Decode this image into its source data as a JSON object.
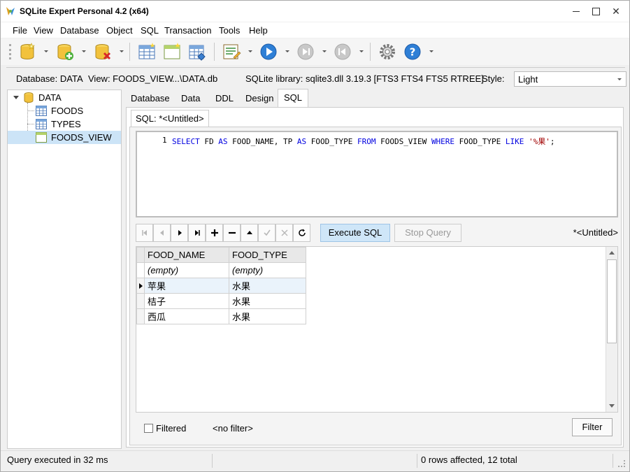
{
  "window": {
    "title": "SQLite Expert Personal 4.2 (x64)"
  },
  "menubar": {
    "items": [
      "File",
      "View",
      "Database",
      "Object",
      "SQL",
      "Transaction",
      "Tools",
      "Help"
    ]
  },
  "toolbar": {
    "buttons": [
      "open-database-icon",
      "new-database-icon",
      "close-database-icon",
      "new-table-icon",
      "new-view-icon",
      "new-index-icon",
      "sql-builder-icon",
      "execute-icon",
      "next-icon",
      "previous-icon",
      "settings-icon",
      "help-icon"
    ]
  },
  "infobar": {
    "database_label": "Database: DATA",
    "view_label": "View: FOODS_VIEW",
    "path": "...\\DATA.db",
    "library": "SQLite library: sqlite3.dll 3.19.3 [FTS3 FTS4 FTS5 RTREE]",
    "style_label": "Style:",
    "style_value": "Light"
  },
  "tree": {
    "root": "DATA",
    "children": [
      "FOODS",
      "TYPES",
      "FOODS_VIEW"
    ],
    "selected": "FOODS_VIEW"
  },
  "tabs": [
    "Database",
    "Data",
    "DDL",
    "Design",
    "SQL"
  ],
  "active_tab": "SQL",
  "sql_tab": {
    "label": "SQL: *<Untitled>"
  },
  "editor": {
    "line_number": "1",
    "kw_select": "SELECT",
    "t1": " FD ",
    "kw_as1": "AS",
    "t2": " FOOD_NAME, TP ",
    "kw_as2": "AS",
    "t3": " FOOD_TYPE ",
    "kw_from": "FROM",
    "t4": " FOODS_VIEW ",
    "kw_where": "WHERE",
    "t5": " FOOD_TYPE ",
    "kw_like": "LIKE",
    "t6": " ",
    "string": "'%果'",
    "t7": ";"
  },
  "query_bar": {
    "execute_label": "Execute SQL",
    "stop_label": "Stop Query",
    "doc_label": "*<Untitled>"
  },
  "grid": {
    "columns": [
      "FOOD_NAME",
      "FOOD_TYPE"
    ],
    "filter_row": [
      "(empty)",
      "(empty)"
    ],
    "rows": [
      [
        "苹果",
        "水果"
      ],
      [
        "桔子",
        "水果"
      ],
      [
        "西瓜",
        "水果"
      ]
    ]
  },
  "filter_bar": {
    "checkbox_label": "Filtered",
    "no_filter": "<no filter>",
    "filter_button": "Filter"
  },
  "statusbar": {
    "left": "Query executed in 32 ms",
    "right": "0 rows affected, 12 total"
  },
  "colors": {
    "keyword": "#0000e0",
    "string": "#a00000",
    "selection": "#cce4f7",
    "execute_button": "#cfe6f8"
  }
}
